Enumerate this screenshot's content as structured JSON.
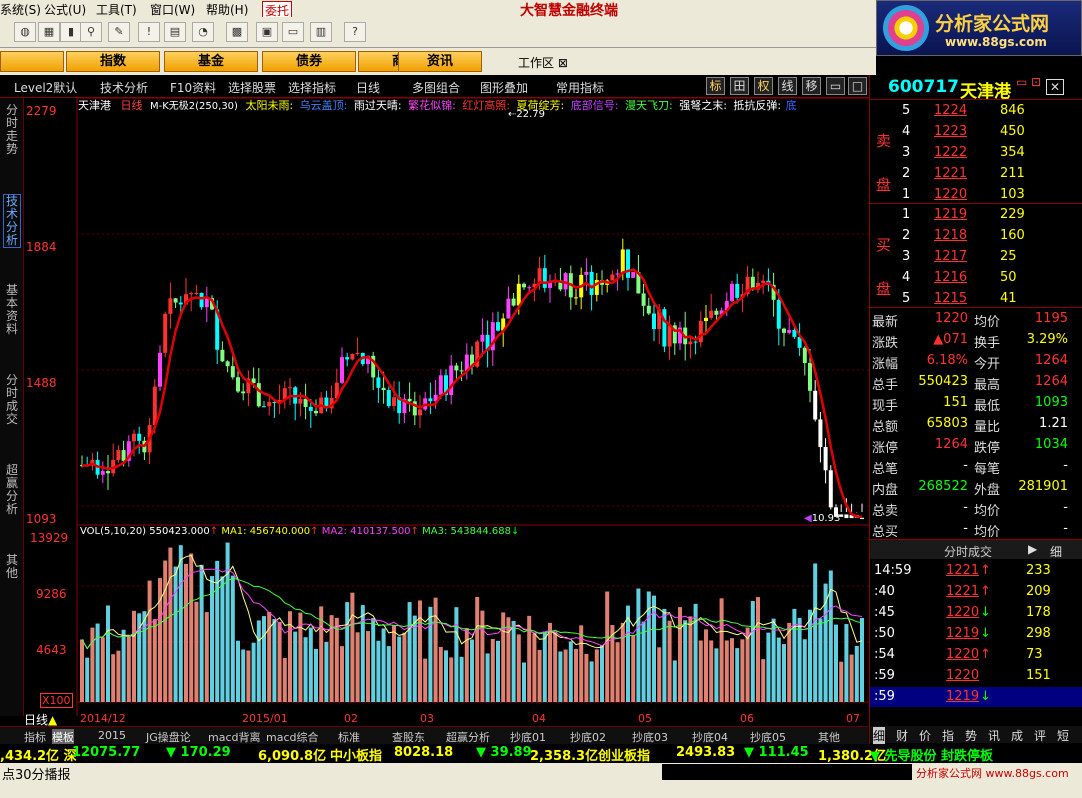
{
  "menu": {
    "items": [
      "系统(S)",
      "公式(U)",
      "工具(T)",
      "窗口(W)",
      "帮助(H)",
      "委托"
    ],
    "app_title": "大智慧金融终端"
  },
  "logo": {
    "line1": "分析家公式网",
    "line2": "www.88gs.com"
  },
  "nav_buttons": [
    "指数",
    "基金",
    "债券",
    "商品",
    "资讯"
  ],
  "workarea_label": "工作区",
  "funcbar": {
    "items": [
      "Level2默认",
      "技术分析",
      "F10资料",
      "选择股票",
      "选择指标",
      "日线",
      "多图组合",
      "图形叠加",
      "常用指标"
    ],
    "right_buttons": [
      "标",
      "田",
      "权",
      "线",
      "移"
    ]
  },
  "left_tabs": [
    "分时走势",
    "技术分析",
    "基本资料",
    "分时成交",
    "超赢分析",
    "其他"
  ],
  "chart_header": {
    "stock": "天津港",
    "period": "日线",
    "indicator": "M-K无极2(250,30)",
    "signals": [
      "太阳未雨:",
      "乌云盖顶:",
      "雨过天晴:",
      "繁花似锦:",
      "红灯高照:",
      "夏荷绽芳:",
      "底部信号:",
      "漫天飞刀:",
      "强弩之末:",
      "抵抗反弹:",
      "底"
    ]
  },
  "price_axis": {
    "labels": [
      "2279",
      "1884",
      "1488",
      "1093"
    ],
    "max_label": "22.79",
    "min_label": "10.93"
  },
  "vol_header": {
    "name": "VOL(5,10,20)",
    "vol": "550423.000",
    "ma1": "MA1: 456740.000",
    "ma2": "MA2: 410137.500",
    "ma3": "MA3: 543844.688"
  },
  "vol_axis": {
    "labels": [
      "13929",
      "9286",
      "4643"
    ],
    "unit": "X100"
  },
  "date_axis": {
    "period_btn": "日线",
    "labels": [
      "2014/12",
      "2015/01",
      "02",
      "03",
      "04",
      "05",
      "06",
      "07"
    ]
  },
  "quote": {
    "code": "600717",
    "name": "天津港",
    "asks": [
      {
        "lvl": "5",
        "p": "1224",
        "v": "846"
      },
      {
        "lvl": "4",
        "p": "1223",
        "v": "450"
      },
      {
        "lvl": "3",
        "p": "1222",
        "v": "354"
      },
      {
        "lvl": "2",
        "p": "1221",
        "v": "211"
      },
      {
        "lvl": "1",
        "p": "1220",
        "v": "103"
      }
    ],
    "bids": [
      {
        "lvl": "1",
        "p": "1219",
        "v": "229"
      },
      {
        "lvl": "2",
        "p": "1218",
        "v": "160"
      },
      {
        "lvl": "3",
        "p": "1217",
        "v": "25"
      },
      {
        "lvl": "4",
        "p": "1216",
        "v": "50"
      },
      {
        "lvl": "5",
        "p": "1215",
        "v": "41"
      }
    ],
    "ask_label": [
      "卖",
      "盘"
    ],
    "bid_label": [
      "买",
      "盘"
    ],
    "stats": [
      {
        "l1": "最新",
        "v1": "1220",
        "l2": "均价",
        "v2": "1195"
      },
      {
        "l1": "涨跌",
        "v1": "▲071",
        "l2": "换手",
        "v2": "3.29%"
      },
      {
        "l1": "涨幅",
        "v1": "6.18%",
        "l2": "今开",
        "v2": "1264"
      },
      {
        "l1": "总手",
        "v1": "550423",
        "l2": "最高",
        "v2": "1264"
      },
      {
        "l1": "现手",
        "v1": "151",
        "l2": "最低",
        "v2": "1093"
      },
      {
        "l1": "总额",
        "v1": "65803",
        "l2": "量比",
        "v2": "1.21"
      },
      {
        "l1": "涨停",
        "v1": "1264",
        "l2": "跌停",
        "v2": "1034"
      },
      {
        "l1": "总笔",
        "v1": "-",
        "l2": "每笔",
        "v2": "-"
      },
      {
        "l1": "内盘",
        "v1": "268522",
        "l2": "外盘",
        "v2": "281901"
      },
      {
        "l1": "总卖",
        "v1": "-",
        "l2": "均价",
        "v2": "-"
      },
      {
        "l1": "总买",
        "v1": "-",
        "l2": "均价",
        "v2": "-"
      }
    ],
    "trades_title": "分时成交",
    "trades_btn": "细",
    "trades": [
      {
        "t": "14:59",
        "p": "1221",
        "d": "↑",
        "v": "233"
      },
      {
        "t": ":40",
        "p": "1221",
        "d": "↑",
        "v": "209"
      },
      {
        "t": ":45",
        "p": "1220",
        "d": "↓",
        "v": "178"
      },
      {
        "t": ":50",
        "p": "1219",
        "d": "↓",
        "v": "298"
      },
      {
        "t": ":54",
        "p": "1220",
        "d": "↑",
        "v": "73"
      },
      {
        "t": ":59",
        "p": "1220",
        "d": "",
        "v": "151"
      },
      {
        "t": ":59",
        "p": "1219",
        "d": "↓",
        "v": ""
      }
    ],
    "bottom_tabs": [
      "细",
      "财",
      "价",
      "指",
      "势",
      "讯",
      "成",
      "评",
      "短"
    ]
  },
  "bottom_tabs": [
    "指标",
    "模板",
    "2015",
    "JG操盘论",
    "macd背离",
    "macd综合",
    "标准",
    "查股东",
    "超赢分析",
    "抄底01",
    "抄底02",
    "抄底03",
    "抄底04",
    "抄底05",
    "其他"
  ],
  "ticker": {
    "text": [
      ",434.2亿 深",
      "12075.77",
      "▼ 170.29",
      "6,090.8亿",
      "中小板指",
      "8028.18",
      "▼ 39.89",
      "2,358.3亿",
      "创业板指",
      "2493.83",
      "▼ 111.45",
      "1,380.2亿",
      "▼ 先导股份 封跌停板"
    ]
  },
  "ticker2": {
    "text": "点30分播报"
  },
  "status_right": "分析家公式网 www.88gs.com",
  "colors": {
    "up": "#ff3232",
    "down": "#00d0d0",
    "ma_red": "#e00000",
    "yellow": "#ffff00",
    "cyan": "#00ffff",
    "bg": "#000000"
  }
}
